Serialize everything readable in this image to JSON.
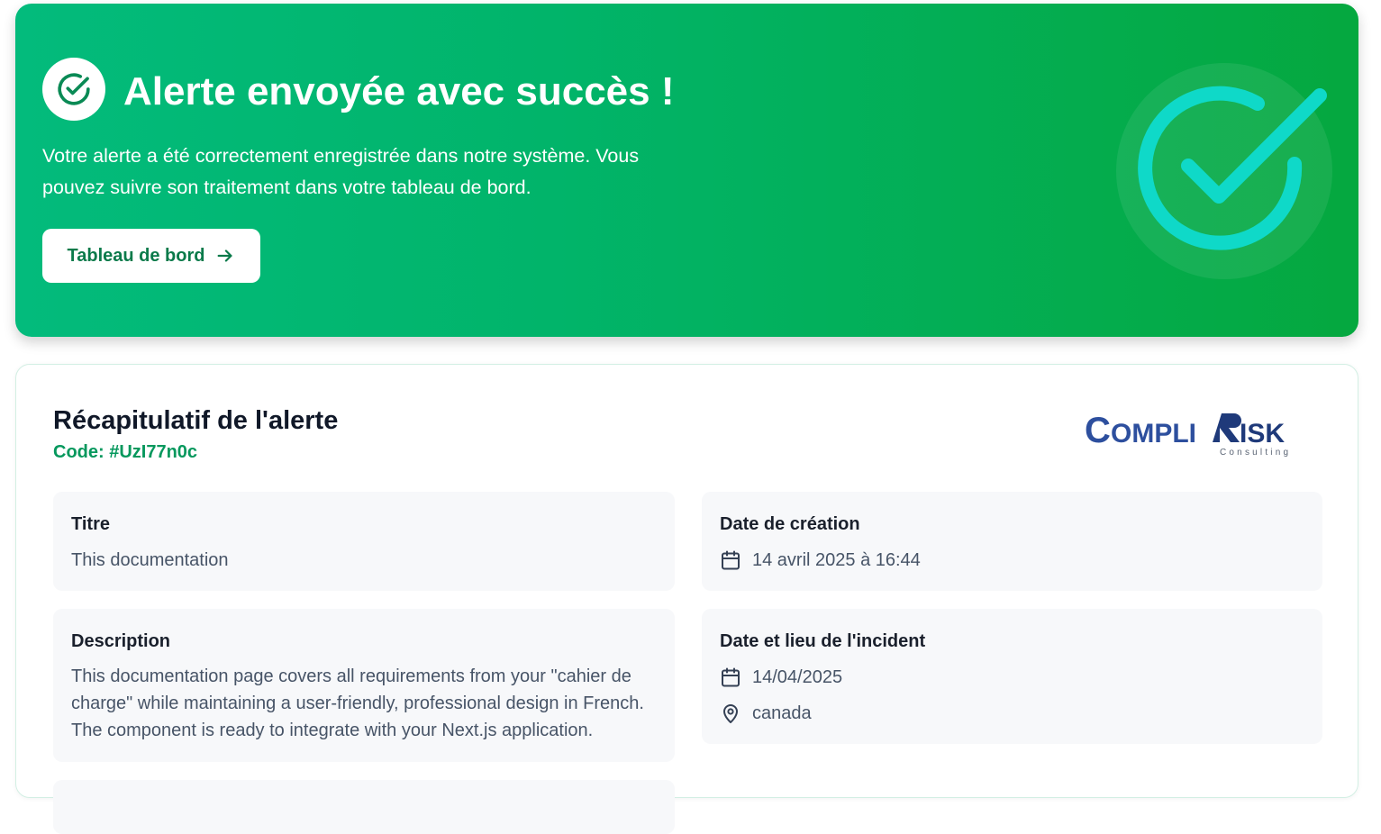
{
  "hero": {
    "title": "Alerte envoyée avec succès !",
    "message": "Votre alerte a été correctement enregistrée dans notre système. Vous pouvez suivre son traitement dans votre tableau de bord.",
    "dashboard_button_label": "Tableau de bord",
    "check_icon": "check-circle-icon",
    "arrow_icon": "arrow-right-icon"
  },
  "summary": {
    "title": "Récapitulatif de l'alerte",
    "code": "Code: #UzI77n0c",
    "logo": {
      "brand_main": "COMPLI",
      "brand_risk": "RISK",
      "brand_sub": "Consulting"
    },
    "fields": {
      "title": {
        "label": "Titre",
        "value": "This documentation"
      },
      "creation_date": {
        "label": "Date de création",
        "value": "14 avril 2025 à 16:44",
        "icon": "calendar-icon"
      },
      "description": {
        "label": "Description",
        "value": "This documentation page covers all requirements from your \"cahier de charge\" while maintaining a user-friendly, professional design in French. The component is ready to integrate with your Next.js application."
      },
      "incident": {
        "label": "Date et lieu de l'incident",
        "date": "14/04/2025",
        "location": "canada",
        "date_icon": "calendar-icon",
        "location_icon": "map-pin-icon"
      }
    }
  },
  "colors": {
    "hero_gradient_start": "#03bb7c",
    "hero_gradient_end": "#05a83f",
    "accent_green": "#06985d",
    "button_text": "#0a7a4a",
    "big_check": "#0fd9c8",
    "logo_blue": "#2d4f9e",
    "field_bg": "#f7f8fa"
  }
}
